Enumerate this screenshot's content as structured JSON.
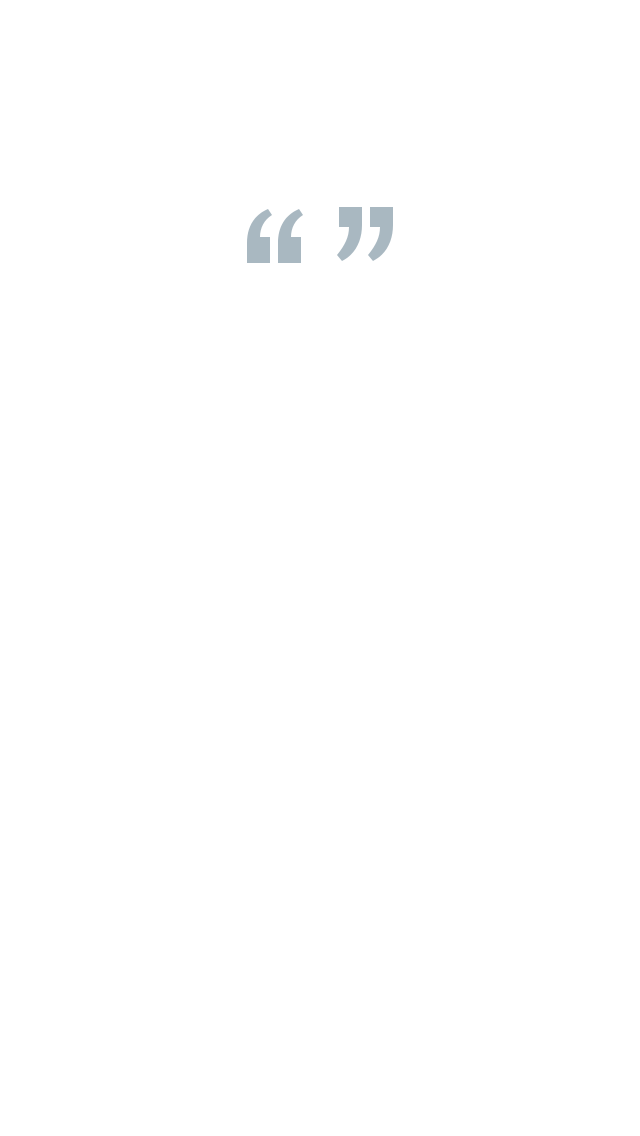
{
  "screen": {
    "background_color": "#ffffff"
  },
  "quote": {
    "open_icon": "opening-quote-icon",
    "close_icon": "closing-quote-icon",
    "color": "#a9b8c1"
  }
}
